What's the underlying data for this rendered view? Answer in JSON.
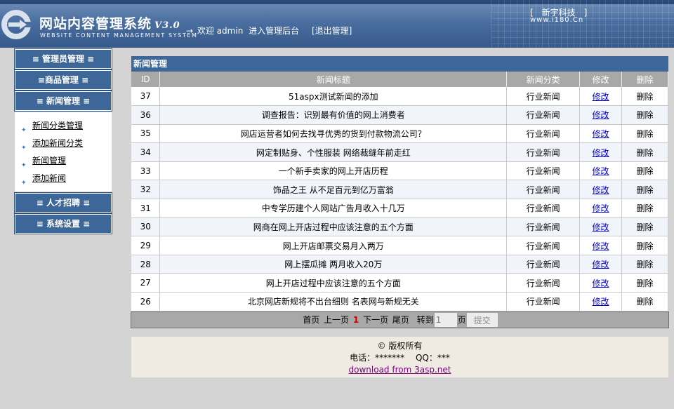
{
  "header": {
    "title": "网站内容管理系统",
    "version": "V3.0",
    "subtitle": "WEBSITE CONTENT MANAGEMENT SYSTEM",
    "welcome_arrow": "→",
    "welcome_text": "欢迎 admin",
    "admin_link": "进入管理后台",
    "logout_link": "[退出管理]",
    "brand": "[　新宇科技　]",
    "brand_url": "www.i180.Cn"
  },
  "sidebar": {
    "menus": [
      {
        "label": "≡ 管理员管理 ≡"
      },
      {
        "label": "≡商品管理 ≡"
      },
      {
        "label": "≡ 新闻管理 ≡"
      },
      {
        "label": "≡ 人才招聘 ≡"
      },
      {
        "label": "≡ 系统设置 ≡"
      }
    ],
    "news_submenu": [
      {
        "label": "新闻分类管理"
      },
      {
        "label": "添加新闻分类"
      },
      {
        "label": "新闻管理"
      },
      {
        "label": "添加新闻"
      }
    ]
  },
  "main": {
    "panel_title": "新闻管理",
    "columns": [
      "ID",
      "新闻标题",
      "新闻分类",
      "修改",
      "删除"
    ],
    "rows": [
      {
        "id": "37",
        "title": "51aspx测试新闻的添加",
        "category": "行业新闻",
        "edit": "修改",
        "delete": "删除"
      },
      {
        "id": "36",
        "title": "调查报告：识别最有价值的网上消费者",
        "category": "行业新闻",
        "edit": "修改",
        "delete": "删除"
      },
      {
        "id": "35",
        "title": "网店运营者如何去找寻优秀的货到付款物流公司？",
        "category": "行业新闻",
        "edit": "修改",
        "delete": "删除"
      },
      {
        "id": "34",
        "title": "网定制贴身、个性服装 网络裁缝年前走红",
        "category": "行业新闻",
        "edit": "修改",
        "delete": "删除"
      },
      {
        "id": "33",
        "title": "一个新手卖家的网上开店历程",
        "category": "行业新闻",
        "edit": "修改",
        "delete": "删除"
      },
      {
        "id": "32",
        "title": "饰品之王 从不足百元到亿万富翁",
        "category": "行业新闻",
        "edit": "修改",
        "delete": "删除"
      },
      {
        "id": "31",
        "title": "中专学历建个人网站广告月收入十几万",
        "category": "行业新闻",
        "edit": "修改",
        "delete": "删除"
      },
      {
        "id": "30",
        "title": "网商在网上开店过程中应该注意的五个方面",
        "category": "行业新闻",
        "edit": "修改",
        "delete": "删除"
      },
      {
        "id": "29",
        "title": "网上开店邮票交易月入两万",
        "category": "行业新闻",
        "edit": "修改",
        "delete": "删除"
      },
      {
        "id": "28",
        "title": "网上摆瓜摊 两月收入20万",
        "category": "行业新闻",
        "edit": "修改",
        "delete": "删除"
      },
      {
        "id": "27",
        "title": "网上开店过程中应该注意的五个方面",
        "category": "行业新闻",
        "edit": "修改",
        "delete": "删除"
      },
      {
        "id": "26",
        "title": "北京网店新规将不出台细则 名表网与新规无关",
        "category": "行业新闻",
        "edit": "修改",
        "delete": "删除"
      }
    ],
    "pager": {
      "first": "首页",
      "prev": "上一页",
      "current": "1",
      "next": "下一页",
      "last": "尾页",
      "goto_label": "转到",
      "page_input_value": "1",
      "page_suffix": "页",
      "submit": "提交"
    }
  },
  "footer": {
    "copyright": "© 版权所有",
    "contact": "电话：*******　 QQ：***",
    "link": "download from 3asp.net"
  },
  "colors": {
    "header_blue": "#4a6fa0",
    "menu_blue": "#3d6799",
    "table_header_gray": "#a8a8a8",
    "link_blue": "#0000cc",
    "current_page_red": "#d30000",
    "footer_bg": "#f0ebe2"
  }
}
